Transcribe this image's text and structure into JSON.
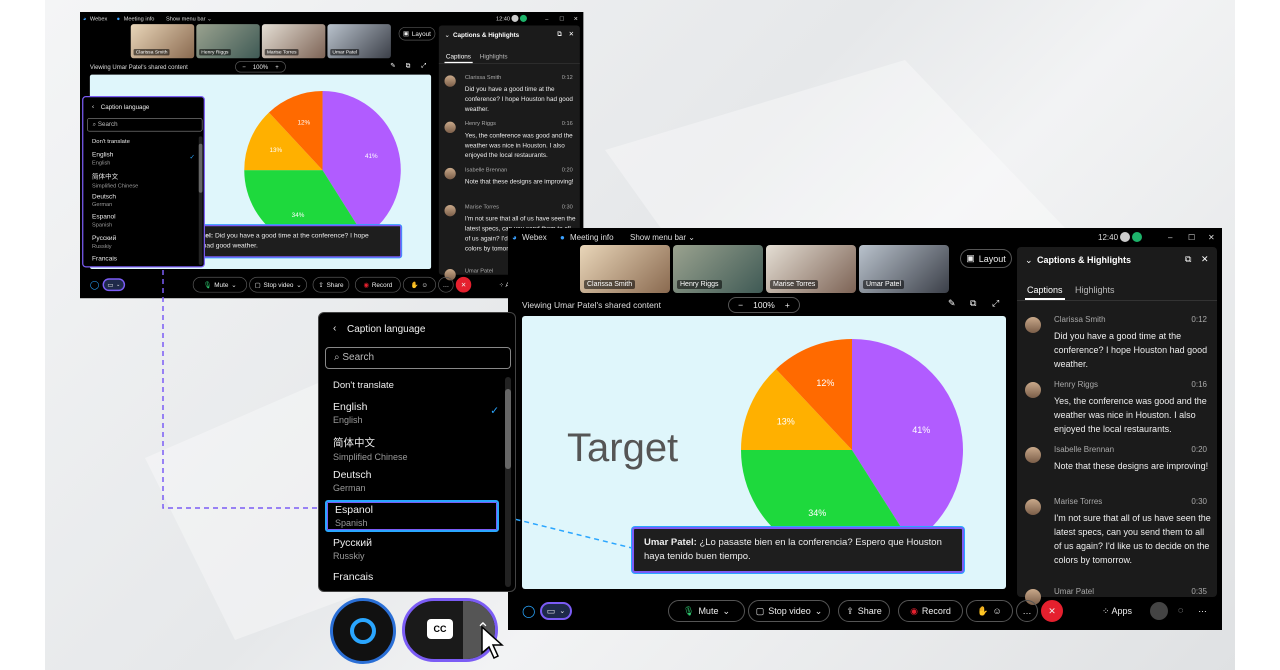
{
  "titlebar": {
    "app": "Webex",
    "meeting_info": "Meeting info",
    "show_menu_bar": "Show menu bar",
    "time": "12:40"
  },
  "participants": [
    {
      "name": "Clarissa Smith"
    },
    {
      "name": "Henry Riggs"
    },
    {
      "name": "Marise Torres"
    },
    {
      "name": "Umar Patel"
    }
  ],
  "layout_label": "Layout",
  "viewing": "Viewing Umar Patel's shared content",
  "zoom": "100%",
  "slide": {
    "title": "Target",
    "slices": [
      {
        "label": "41%",
        "value": 41,
        "color": "#b15cff"
      },
      {
        "label": "34%",
        "value": 34,
        "color": "#1ed93d"
      },
      {
        "label": "13%",
        "value": 13,
        "color": "#ffb000"
      },
      {
        "label": "12%",
        "value": 12,
        "color": "#ff6a00"
      }
    ]
  },
  "caption": {
    "speaker": "Umar Patel:",
    "text": "¿Lo pasaste bien en la conferencia? Espero que Houston haya tenido buen tiempo."
  },
  "caption_small": {
    "speaker": "Umar Patel:",
    "text": "Did you have a good time at the conference? I hope Houston had good weather."
  },
  "panel": {
    "title": "Captions & Highlights",
    "tabs": [
      "Captions",
      "Highlights"
    ],
    "entries": [
      {
        "name": "Clarissa Smith",
        "time": "0:12",
        "text": "Did you have a good time at the conference? I hope Houston had good weather."
      },
      {
        "name": "Henry Riggs",
        "time": "0:16",
        "text": "Yes, the conference was good and the weather was nice in Houston. I also enjoyed the local restaurants."
      },
      {
        "name": "Isabelle Brennan",
        "time": "0:20",
        "text": "Note that these designs are improving!"
      },
      {
        "name": "Marise Torres",
        "time": "0:30",
        "text": "I'm not sure that all of us have seen the latest specs, can you send them to all of us again? I'd like us to decide on the colors by tomorrow."
      },
      {
        "name": "Umar Patel",
        "time": "0:35",
        "text": ""
      }
    ]
  },
  "controls": {
    "mute": "Mute",
    "stop_video": "Stop video",
    "share": "Share",
    "record": "Record",
    "apps": "Apps"
  },
  "language_popup": {
    "title": "Caption language",
    "search_placeholder": "Search",
    "dont_translate": "Don't translate",
    "languages": [
      {
        "name": "English",
        "sub": "English",
        "checked": true
      },
      {
        "name": "简体中文",
        "sub": "Simplified Chinese"
      },
      {
        "name": "Deutsch",
        "sub": "German"
      },
      {
        "name": "Espanol",
        "sub": "Spanish",
        "highlighted": true
      },
      {
        "name": "Русский",
        "sub": "Russkiy"
      },
      {
        "name": "Francais",
        "sub": ""
      }
    ]
  },
  "cc_label": "CC",
  "colors": {
    "accent_blue": "#2aa6ff",
    "accent_purple": "#7b5cf5",
    "end_call": "#e5202e"
  }
}
